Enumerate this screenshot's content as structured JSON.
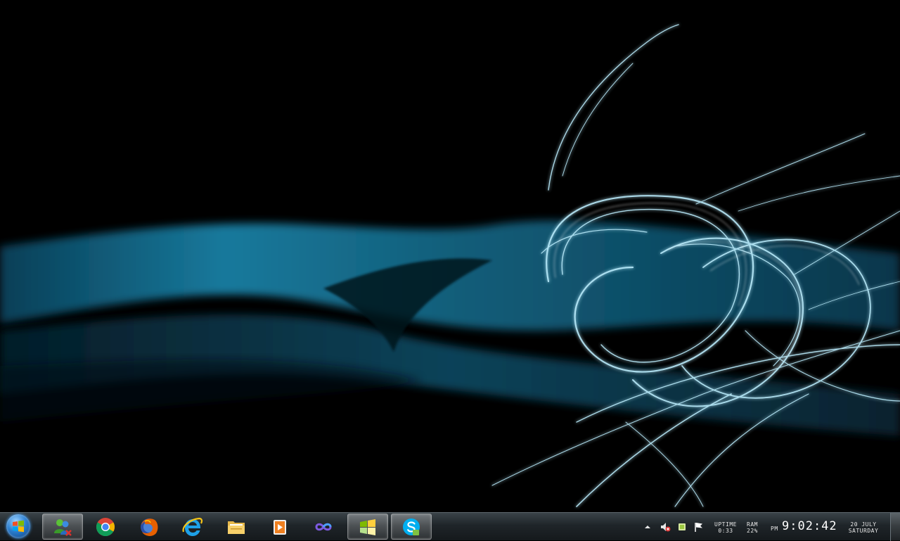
{
  "desktop": {
    "wallpaper": "abstract-cyan-light-swirl",
    "background_color": "#000000",
    "accent_color": "#2fb7e0"
  },
  "taskbar": {
    "start_button": {
      "icon": "windows-flag-icon"
    },
    "pinned_apps": [
      {
        "name": "windows-live-messenger",
        "icon": "messenger-icon",
        "active": true
      },
      {
        "name": "google-chrome",
        "icon": "chrome-icon",
        "active": false
      },
      {
        "name": "mozilla-firefox",
        "icon": "firefox-icon",
        "active": false
      },
      {
        "name": "internet-explorer",
        "icon": "ie-icon",
        "active": false
      },
      {
        "name": "windows-explorer",
        "icon": "folder-icon",
        "active": false
      },
      {
        "name": "media-player",
        "icon": "media-player-icon",
        "active": false
      },
      {
        "name": "visual-studio",
        "icon": "infinity-icon",
        "active": false
      },
      {
        "name": "windows-flag-app",
        "icon": "windows-logo-icon",
        "active": true
      },
      {
        "name": "skype",
        "icon": "skype-icon",
        "active": true
      }
    ],
    "tray": {
      "show_hidden_icon": "up-arrow-icon",
      "icons": [
        "volume-muted-icon",
        "network-icon",
        "action-center-flag-icon"
      ],
      "uptime": {
        "label": "UPTIME",
        "value": "0:33"
      },
      "ram": {
        "label": "RAM",
        "value": "22%"
      },
      "clock": {
        "ampm": "PM",
        "time": "9:02:42"
      },
      "date": {
        "line1": "20 JULY",
        "line2": "SATURDAY"
      }
    }
  }
}
